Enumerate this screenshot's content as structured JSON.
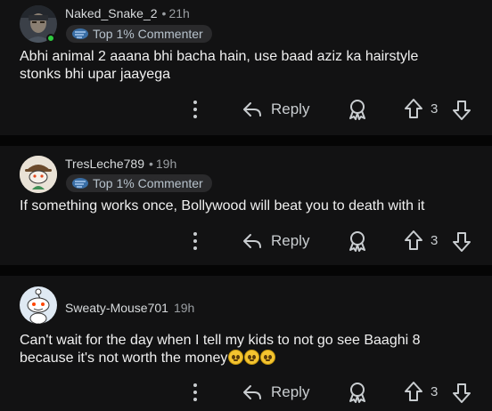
{
  "comments": [
    {
      "username": "Naked_Snake_2",
      "time": "21h",
      "badge": "Top 1% Commenter",
      "body_line1": "Abhi animal 2 aaana bhi bacha hain, use baad aziz ka hairstyle",
      "body_line2": "stonks bhi upar jaayega",
      "reply_label": "Reply",
      "score": "3",
      "avatar": "soldier-avatar",
      "online": true
    },
    {
      "username": "TresLeche789",
      "time": "19h",
      "badge": "Top 1% Commenter",
      "body_line1": "If something works once, Bollywood will beat you to death with it",
      "reply_label": "Reply",
      "score": "3",
      "avatar": "snoo-cowboy-avatar"
    },
    {
      "username": "Sweaty-Mouse701",
      "time": "19h",
      "body_line1": "Can't wait for the day when I tell my kids to not go see Baaghi 8",
      "body_line2": "because it's not worth the money",
      "emojis": "pleading-face x3",
      "reply_label": "Reply",
      "score": "3",
      "avatar": "snoo-default-avatar"
    }
  ],
  "colors": {
    "background": "#121213",
    "separator": "#050505",
    "text": "#f0f0f0",
    "muted": "#9a9ea2",
    "online": "#2ecc40"
  },
  "icons": [
    "more-vertical-icon",
    "reply-arrow-icon",
    "award-icon",
    "upvote-icon",
    "downvote-icon",
    "commenter-badge-icon"
  ]
}
